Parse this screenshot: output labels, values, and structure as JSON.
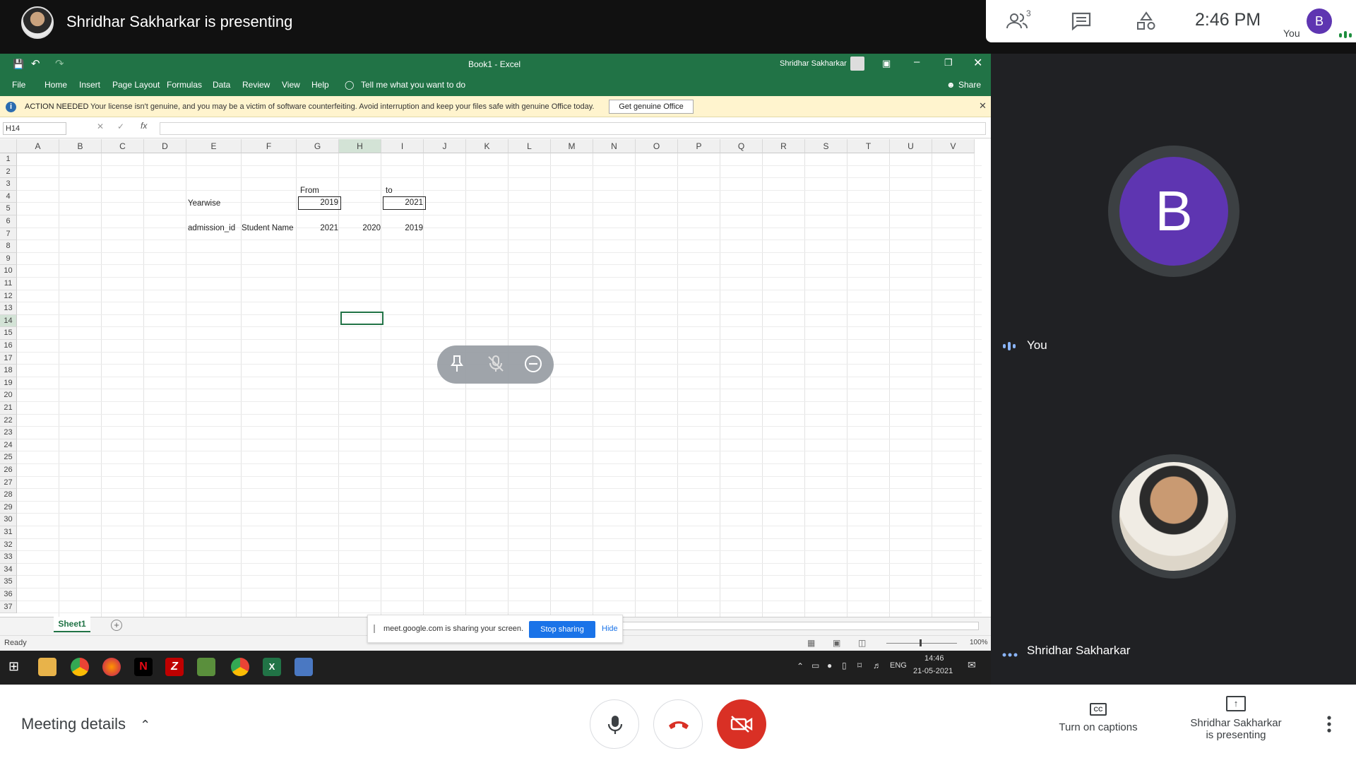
{
  "top_bar": {
    "presenting_title": "Shridhar Sakharkar is presenting",
    "participants_count": "3",
    "time": "2:46 PM",
    "you_avatar_letter": "B",
    "you_label": "You",
    "icons": [
      "people-icon",
      "chat-icon",
      "activities-icon"
    ]
  },
  "excel": {
    "window_title": "Book1 - Excel",
    "user_name": "Shridhar Sakharkar",
    "ribbon_tabs": [
      "File",
      "Home",
      "Insert",
      "Page Layout",
      "Formulas",
      "Data",
      "Review",
      "View",
      "Help"
    ],
    "tell_me": "Tell me what you want to do",
    "share": "Share",
    "notice": {
      "label": "ACTION NEEDED",
      "text": "Your license isn't genuine, and you may be a victim of software counterfeiting. Avoid interruption and keep your files safe with genuine Office today.",
      "button": "Get genuine Office"
    },
    "name_box": "H14",
    "columns": [
      "A",
      "B",
      "C",
      "D",
      "E",
      "F",
      "G",
      "H",
      "I",
      "J",
      "K",
      "L",
      "M",
      "N",
      "O",
      "P",
      "Q",
      "R",
      "S",
      "T",
      "U",
      "V"
    ],
    "rows": [
      "1",
      "2",
      "3",
      "4",
      "5",
      "6",
      "7",
      "8",
      "9",
      "10",
      "11",
      "12",
      "13",
      "14",
      "15",
      "16",
      "17",
      "18",
      "19",
      "20",
      "21",
      "22",
      "23",
      "24",
      "25",
      "26",
      "27",
      "28",
      "29",
      "30",
      "31",
      "32",
      "33",
      "34",
      "35",
      "36",
      "37"
    ],
    "cells": {
      "G4": "From",
      "I4": "to",
      "E5": "Yearwise",
      "G5": "2019",
      "I5": "2021",
      "E7": "admission_id",
      "F7": "Student Name",
      "G7": "2021",
      "H7": "2020",
      "I7": "2019"
    },
    "sheet_tab": "Sheet1",
    "status": "Ready",
    "zoom": "100%"
  },
  "share_bar": {
    "text": "meet.google.com is sharing your screen.",
    "stop": "Stop sharing",
    "hide": "Hide"
  },
  "taskbar": {
    "lang": "ENG",
    "time": "14:46",
    "date": "21-05-2021"
  },
  "participants": {
    "you": {
      "avatar_letter": "B",
      "name": "You",
      "avatar_color": "#5e35b1"
    },
    "presenter": {
      "name": "Shridhar Sakharkar"
    }
  },
  "bottom_bar": {
    "meeting_details": "Meeting details",
    "captions": "Turn on captions",
    "presenting_line1": "Shridhar Sakharkar",
    "presenting_line2": "is presenting",
    "end_call_color": "#d93025"
  }
}
